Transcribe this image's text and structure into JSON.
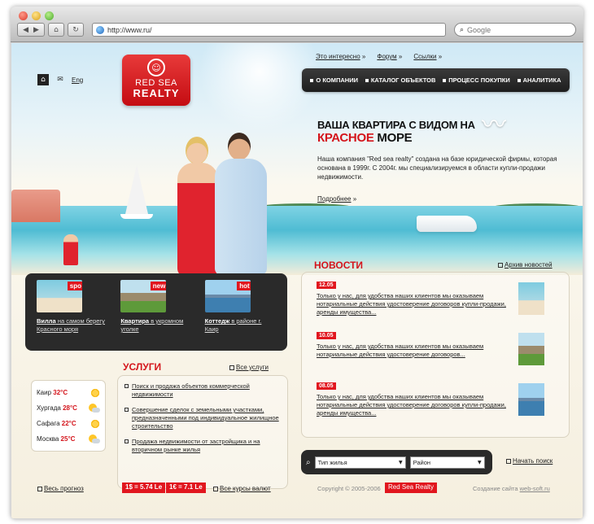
{
  "browser": {
    "url": "http://www.ru/",
    "search_placeholder": "Google",
    "back_glyph": "◀",
    "fwd_glyph": "▶",
    "home_glyph": "⌂",
    "reload_glyph": "↻"
  },
  "header": {
    "logo_line1": "RED SEA",
    "logo_line2": "REALTY",
    "logo_emblem": "☺",
    "lang_link": "Eng",
    "top_links": [
      "Это интересно",
      "Форум",
      "Ссылки"
    ],
    "link_arrow": "»",
    "nav": [
      "О КОМПАНИИ",
      "КАТАЛОГ ОБЪЕКТОВ",
      "ПРОЦЕСС ПОКУПКИ",
      "АНАЛИТИКА"
    ]
  },
  "hero": {
    "title_line1": "ВАША КВАРТИРА С ВИДОМ НА",
    "title_line2_accent": "КРАСНОЕ",
    "title_line2_rest": " МОРЕ",
    "text": "Наша компания \"Red sea realty\" создана на базе юридической фирмы, которая основана в 1999г. С 2004г. мы специализируемся в области купли-продажи недвижимости.",
    "more_label": "Подробнее"
  },
  "properties": [
    {
      "tag": "spo",
      "title": "Вилла",
      "desc": " на самом берегу Красного моря"
    },
    {
      "tag": "new",
      "title": "Квартира",
      "desc": " в укромном уголке"
    },
    {
      "tag": "hot",
      "title": "Коттедж",
      "desc": " в районе г. Каир"
    }
  ],
  "news": {
    "heading": "НОВОСТИ",
    "archive_label": "Архив новостей",
    "items": [
      {
        "date": "12.05",
        "text": "Только у нас, для удобства наших клиентов мы оказываем нотариальные действия удостоверение договоров купли-продажи, аренды имущества..."
      },
      {
        "date": "10.05",
        "text": "Только у нас, для удобства наших клиентов мы оказываем нотариальные действия удостоверение договоров..."
      },
      {
        "date": "08.05",
        "text": "Только у нас, для удобства наших клиентов мы оказываем нотариальные действия удостоверение договоров купли-продажи, аренды имущества..."
      }
    ]
  },
  "services": {
    "heading": "УСЛУГИ",
    "all_label": "Все услуги",
    "items": [
      "Поиск и продажа объектов коммерческой недвижимости",
      "Совершение сделок с земельными участками, предназначенными под индивидуальное жилищное строительство",
      "Продажа недвижимости от застройщика и на вторичном рынке жилья"
    ]
  },
  "weather": [
    {
      "city": "Каир",
      "temp": "32°C",
      "icon": "sun-icon"
    },
    {
      "city": "Хургада",
      "temp": "28°C",
      "icon": "partly-cloudy-icon"
    },
    {
      "city": "Сафага",
      "temp": "22°C",
      "icon": "sun-icon"
    },
    {
      "city": "Москва",
      "temp": "25°C",
      "icon": "partly-cloudy-icon"
    }
  ],
  "search": {
    "type_label": "Тип жилья",
    "region_label": "Район",
    "start_label": "Начать поиск"
  },
  "footer": {
    "forecast_label": "Весь прогноз",
    "rate_usd": "1$ = 5.74 Le",
    "rate_eur": "1€ = 7.1 Le",
    "all_rates_label": "Все курсы валют",
    "copyright": "Copyright © 2005-2006",
    "copyright_badge": "Red Sea Realty",
    "created_prefix": "Создание сайта ",
    "created_link": "web-soft.ru"
  },
  "colors": {
    "accent": "#d4141b",
    "dark_panel": "#2a2a2a"
  }
}
